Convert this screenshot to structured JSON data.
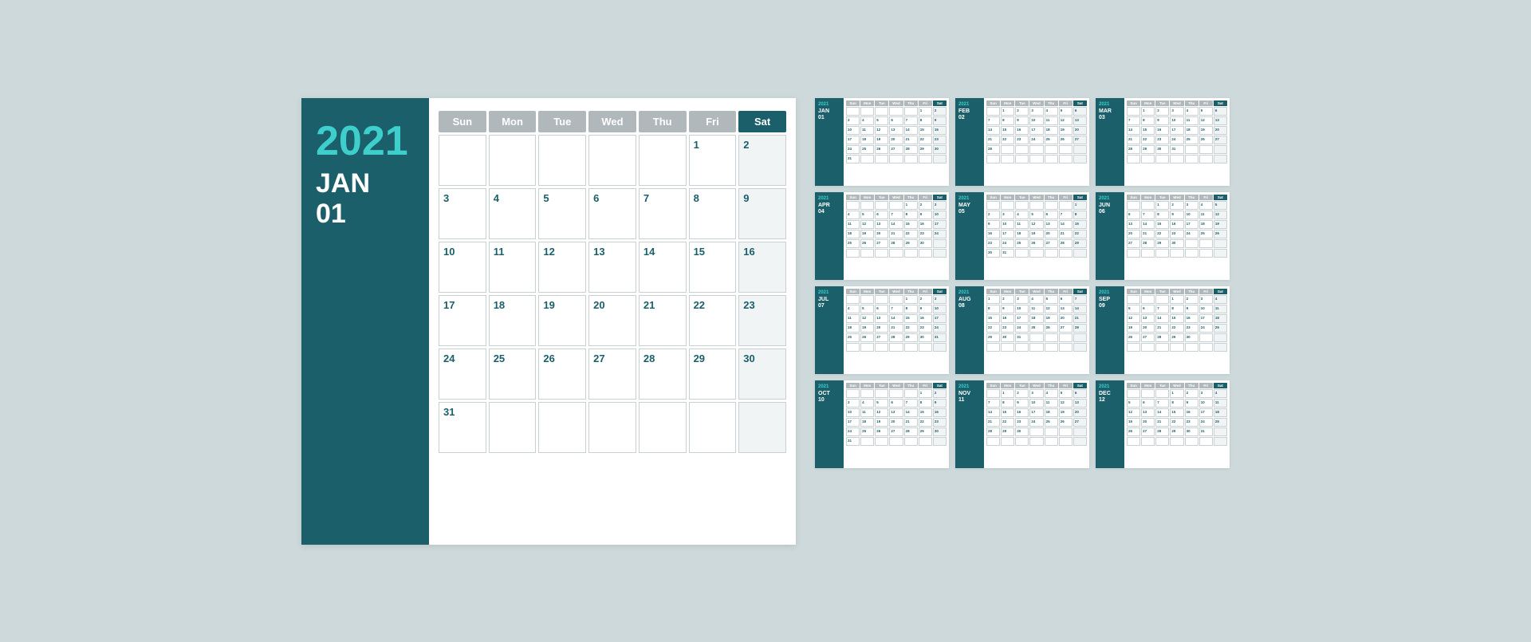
{
  "main_calendar": {
    "year": "2021",
    "month": "JAN",
    "number": "01",
    "days_header": [
      "Sun",
      "Mon",
      "Tue",
      "Wed",
      "Thu",
      "Fri",
      "Sat"
    ],
    "weeks": [
      [
        "",
        "",
        "",
        "",
        "",
        "1",
        "2"
      ],
      [
        "3",
        "4",
        "5",
        "6",
        "7",
        "8",
        "9"
      ],
      [
        "10",
        "11",
        "12",
        "13",
        "14",
        "15",
        "16"
      ],
      [
        "17",
        "18",
        "19",
        "20",
        "21",
        "22",
        "23"
      ],
      [
        "24",
        "25",
        "26",
        "27",
        "28",
        "29",
        "30"
      ],
      [
        "31",
        "",
        "",
        "",
        "",
        "",
        ""
      ]
    ]
  },
  "mini_calendars": [
    {
      "year": "2021",
      "month": "JAN",
      "num": "01",
      "weeks": [
        [
          "",
          "",
          "",
          "",
          "",
          "1",
          "2"
        ],
        [
          "3",
          "4",
          "5",
          "6",
          "7",
          "8",
          "9"
        ],
        [
          "10",
          "11",
          "12",
          "13",
          "14",
          "15",
          "16"
        ],
        [
          "17",
          "18",
          "19",
          "20",
          "21",
          "22",
          "23"
        ],
        [
          "24",
          "25",
          "26",
          "27",
          "28",
          "29",
          "30"
        ],
        [
          "31",
          "",
          "",
          "",
          "",
          "",
          ""
        ]
      ]
    },
    {
      "year": "2021",
      "month": "FEB",
      "num": "02",
      "weeks": [
        [
          "",
          "1",
          "2",
          "3",
          "4",
          "5",
          "6"
        ],
        [
          "7",
          "8",
          "9",
          "10",
          "11",
          "12",
          "13"
        ],
        [
          "14",
          "15",
          "16",
          "17",
          "18",
          "19",
          "20"
        ],
        [
          "21",
          "22",
          "23",
          "24",
          "25",
          "26",
          "27"
        ],
        [
          "28",
          "",
          "",
          "",
          "",
          "",
          ""
        ],
        [
          "",
          "",
          "",
          "",
          "",
          "",
          ""
        ]
      ]
    },
    {
      "year": "2021",
      "month": "MAR",
      "num": "03",
      "weeks": [
        [
          "",
          "1",
          "2",
          "3",
          "4",
          "5",
          "6"
        ],
        [
          "7",
          "8",
          "9",
          "10",
          "11",
          "12",
          "13"
        ],
        [
          "14",
          "15",
          "16",
          "17",
          "18",
          "19",
          "20"
        ],
        [
          "21",
          "22",
          "23",
          "24",
          "25",
          "26",
          "27"
        ],
        [
          "28",
          "29",
          "30",
          "31",
          "",
          "",
          ""
        ],
        [
          "",
          "",
          "",
          "",
          "",
          "",
          ""
        ]
      ]
    },
    {
      "year": "2021",
      "month": "APR",
      "num": "04",
      "weeks": [
        [
          "",
          "",
          "",
          "",
          "1",
          "2",
          "3"
        ],
        [
          "4",
          "5",
          "6",
          "7",
          "8",
          "9",
          "10"
        ],
        [
          "11",
          "12",
          "13",
          "14",
          "15",
          "16",
          "17"
        ],
        [
          "18",
          "19",
          "20",
          "21",
          "22",
          "23",
          "24"
        ],
        [
          "25",
          "26",
          "27",
          "28",
          "29",
          "30",
          ""
        ],
        [
          "",
          "",
          "",
          "",
          "",
          "",
          ""
        ]
      ]
    },
    {
      "year": "2021",
      "month": "MAY",
      "num": "05",
      "weeks": [
        [
          "",
          "",
          "",
          "",
          "",
          "",
          "1"
        ],
        [
          "2",
          "3",
          "4",
          "5",
          "6",
          "7",
          "8"
        ],
        [
          "9",
          "10",
          "11",
          "12",
          "13",
          "14",
          "15"
        ],
        [
          "16",
          "17",
          "18",
          "19",
          "20",
          "21",
          "22"
        ],
        [
          "23",
          "24",
          "25",
          "26",
          "27",
          "28",
          "29"
        ],
        [
          "30",
          "31",
          "",
          "",
          "",
          "",
          ""
        ]
      ]
    },
    {
      "year": "2021",
      "month": "JUN",
      "num": "06",
      "weeks": [
        [
          "",
          "",
          "1",
          "2",
          "3",
          "4",
          "5"
        ],
        [
          "6",
          "7",
          "8",
          "9",
          "10",
          "11",
          "12"
        ],
        [
          "13",
          "14",
          "15",
          "16",
          "17",
          "18",
          "19"
        ],
        [
          "20",
          "21",
          "22",
          "23",
          "24",
          "25",
          "26"
        ],
        [
          "27",
          "28",
          "29",
          "30",
          "",
          "",
          ""
        ],
        [
          "",
          "",
          "",
          "",
          "",
          "",
          ""
        ]
      ]
    },
    {
      "year": "2021",
      "month": "JUL",
      "num": "07",
      "weeks": [
        [
          "",
          "",
          "",
          "",
          "1",
          "2",
          "3"
        ],
        [
          "4",
          "5",
          "6",
          "7",
          "8",
          "9",
          "10"
        ],
        [
          "11",
          "12",
          "13",
          "14",
          "15",
          "16",
          "17"
        ],
        [
          "18",
          "19",
          "20",
          "21",
          "22",
          "23",
          "24"
        ],
        [
          "25",
          "26",
          "27",
          "28",
          "29",
          "30",
          "31"
        ],
        [
          "",
          "",
          "",
          "",
          "",
          "",
          ""
        ]
      ]
    },
    {
      "year": "2021",
      "month": "AUG",
      "num": "08",
      "weeks": [
        [
          "1",
          "2",
          "3",
          "4",
          "5",
          "6",
          "7"
        ],
        [
          "8",
          "9",
          "10",
          "11",
          "12",
          "13",
          "14"
        ],
        [
          "15",
          "16",
          "17",
          "18",
          "19",
          "20",
          "21"
        ],
        [
          "22",
          "23",
          "24",
          "25",
          "26",
          "27",
          "28"
        ],
        [
          "29",
          "30",
          "31",
          "",
          "",
          "",
          ""
        ],
        [
          "",
          "",
          "",
          "",
          "",
          "",
          ""
        ]
      ]
    },
    {
      "year": "2021",
      "month": "SEP",
      "num": "09",
      "weeks": [
        [
          "",
          "",
          "",
          "1",
          "2",
          "3",
          "4"
        ],
        [
          "5",
          "6",
          "7",
          "8",
          "9",
          "10",
          "11"
        ],
        [
          "12",
          "13",
          "14",
          "15",
          "16",
          "17",
          "18"
        ],
        [
          "19",
          "20",
          "21",
          "22",
          "23",
          "24",
          "25"
        ],
        [
          "26",
          "27",
          "28",
          "29",
          "30",
          "",
          ""
        ],
        [
          "",
          "",
          "",
          "",
          "",
          "",
          ""
        ]
      ]
    },
    {
      "year": "2021",
      "month": "OCT",
      "num": "10",
      "weeks": [
        [
          "",
          "",
          "",
          "",
          "",
          "1",
          "2"
        ],
        [
          "3",
          "4",
          "5",
          "6",
          "7",
          "8",
          "9"
        ],
        [
          "10",
          "11",
          "12",
          "13",
          "14",
          "15",
          "16"
        ],
        [
          "17",
          "18",
          "19",
          "20",
          "21",
          "22",
          "23"
        ],
        [
          "24",
          "25",
          "26",
          "27",
          "28",
          "29",
          "30"
        ],
        [
          "31",
          "",
          "",
          "",
          "",
          "",
          ""
        ]
      ]
    },
    {
      "year": "2021",
      "month": "NOV",
      "num": "11",
      "weeks": [
        [
          "",
          "1",
          "2",
          "3",
          "4",
          "5",
          "6"
        ],
        [
          "7",
          "8",
          "9",
          "10",
          "11",
          "12",
          "13"
        ],
        [
          "14",
          "15",
          "16",
          "17",
          "18",
          "19",
          "20"
        ],
        [
          "21",
          "22",
          "23",
          "24",
          "25",
          "26",
          "27"
        ],
        [
          "28",
          "29",
          "30",
          "",
          "",
          "",
          ""
        ],
        [
          "",
          "",
          "",
          "",
          "",
          "",
          ""
        ]
      ]
    },
    {
      "year": "2021",
      "month": "DEC",
      "num": "12",
      "weeks": [
        [
          "",
          "",
          "",
          "1",
          "2",
          "3",
          "4"
        ],
        [
          "5",
          "6",
          "7",
          "8",
          "9",
          "10",
          "11"
        ],
        [
          "12",
          "13",
          "14",
          "15",
          "16",
          "17",
          "18"
        ],
        [
          "19",
          "20",
          "21",
          "22",
          "23",
          "24",
          "25"
        ],
        [
          "26",
          "27",
          "28",
          "29",
          "30",
          "31",
          ""
        ],
        [
          "",
          "",
          "",
          "",
          "",
          "",
          ""
        ]
      ]
    }
  ],
  "days_header_mini": [
    "Sun",
    "Mon",
    "Tue",
    "Wed",
    "Thu",
    "Fri",
    "Sat"
  ]
}
